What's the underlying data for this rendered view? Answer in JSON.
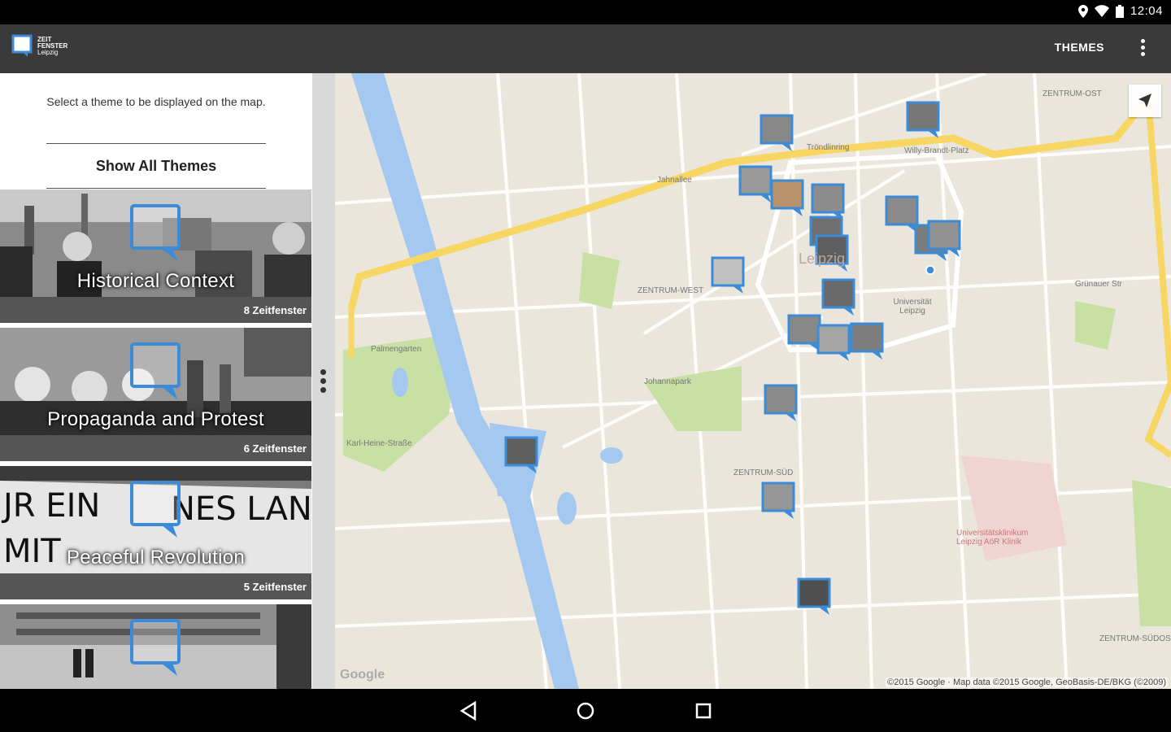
{
  "status_bar": {
    "time": "12:04",
    "icons": [
      "location-icon",
      "wifi-icon",
      "battery-icon"
    ]
  },
  "app_bar": {
    "logo": {
      "line1": "ZEIT",
      "line2": "FENSTER",
      "line3": "Leipzig"
    },
    "themes_label": "THEMES"
  },
  "panel": {
    "intro": "Select a theme to be displayed on the map.",
    "show_all": "Show All Themes",
    "themes": [
      {
        "title": "Historical Context",
        "count": "8 Zeitfenster"
      },
      {
        "title": "Propaganda and Protest",
        "count": "6 Zeitfenster"
      },
      {
        "title": "Peaceful Revolution",
        "count": "5 Zeitfenster"
      },
      {
        "title": "",
        "count": ""
      }
    ]
  },
  "map": {
    "labels": {
      "zentrum_west": "ZENTRUM-WEST",
      "zentrum_sud": "ZENTRUM-SÜD",
      "zentrum_ost": "ZENTRUM-OST",
      "zentrum_sudost": "ZENTRUM-SÜDOST",
      "leipzig": "Leipzig",
      "universitat": "Universität Leipzig",
      "johannapark": "Johannapark",
      "palmengarten": "Palmengarten",
      "uniklinik": "Universitätsklinikum Leipzig AöR Klinik",
      "tropen": "Tröndlinring",
      "willy": "Willy-Brandt-Platz",
      "karl": "Karl-Heine-Straße",
      "jahnallee": "Jahnallee",
      "grunauer": "Grünauer Str"
    },
    "google": "Google",
    "copyright": "©2015 Google · Map data ©2015 Google, GeoBasis-DE/BKG (©2009)",
    "accent_color": "#3b8bd6",
    "road_yellow": "#f7d663",
    "water_color": "#a5c8f0",
    "park_color": "#c8e0a4"
  },
  "nav": {
    "icons": [
      "back-icon",
      "home-icon",
      "recents-icon"
    ]
  }
}
